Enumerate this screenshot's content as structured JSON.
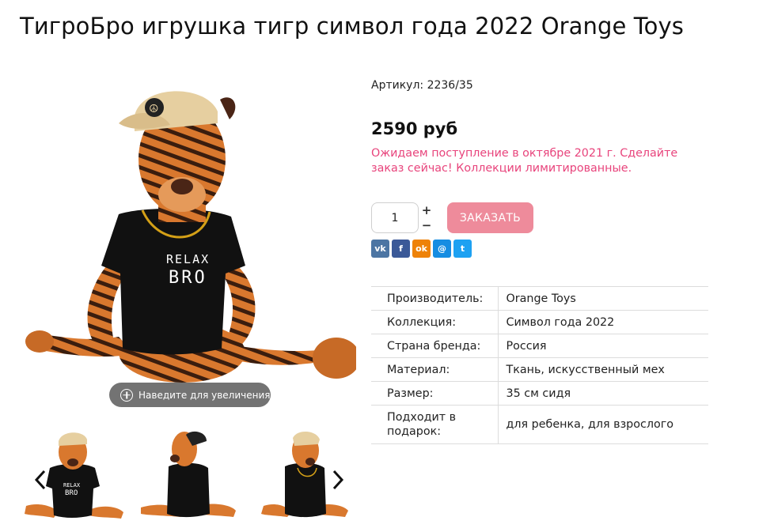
{
  "product": {
    "title": "ТигроБро игрушка тигр символ года 2022 Orange Toys",
    "sku": "Артикул: 2236/35",
    "price": "2590 руб",
    "notice": "Ожидаем поступление в октябре 2021 г. Сделайте заказ сейчас! Коллекции лимитированные."
  },
  "gallery": {
    "zoom_hint": "Наведите для увеличения",
    "shirt_text_line1": "RELAX",
    "shirt_text_line2": "BRO"
  },
  "purchase": {
    "quantity": "1",
    "plus_label": "+",
    "minus_label": "−",
    "order_label": "ЗАКАЗАТЬ",
    "order_color": "#ee8b9b"
  },
  "share": [
    {
      "icon": "vk-icon",
      "label": "vk",
      "color": "#4c75a3"
    },
    {
      "icon": "facebook-icon",
      "label": "f",
      "color": "#3b5998"
    },
    {
      "icon": "odnoklassniki-icon",
      "label": "ok",
      "color": "#ee8208"
    },
    {
      "icon": "moimir-icon",
      "label": "@",
      "color": "#168de2"
    },
    {
      "icon": "twitter-icon",
      "label": "t",
      "color": "#1da1f2"
    }
  ],
  "specs": [
    {
      "key": "Производитель:",
      "value": "Orange Toys"
    },
    {
      "key": "Коллекция:",
      "value": "Символ года 2022"
    },
    {
      "key": "Страна бренда:",
      "value": "Россия"
    },
    {
      "key": "Материал:",
      "value": "Ткань, искусственный мех"
    },
    {
      "key": "Размер:",
      "value": "35 см сидя"
    },
    {
      "key": "Подходит в подарок:",
      "value": "для ребенка, для взрослого"
    }
  ],
  "colors": {
    "accent_pink": "#e8447c",
    "tiger_orange": "#d9782e",
    "shirt_black": "#111111"
  }
}
